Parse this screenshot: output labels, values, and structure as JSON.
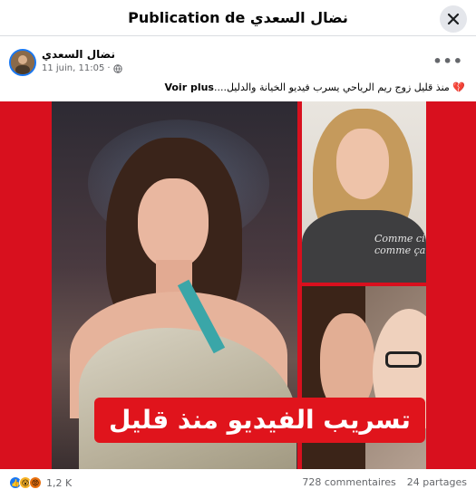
{
  "dialog": {
    "title": "Publication de نضال السعدي"
  },
  "post": {
    "author": "نضال السعدي",
    "date": "11 juin, 11:05",
    "privacy_separator": "·",
    "caption_text": "منذ قليل زوج ريم الرياحي يسرب فيديو الخيانة والدليل....",
    "see_more_label": "Voir plus",
    "overlay_text": "تسريب الفيديو منذ قليل",
    "shirt_text_line1": "Comme ci",
    "shirt_text_line2": "comme ça"
  },
  "engagement": {
    "reaction_count": "1,2 K",
    "comments": "728 commentaires",
    "shares": "24 partages"
  },
  "colors": {
    "accent": "#1877f2",
    "media_background": "#d8101e",
    "overlay": "#e0141c"
  },
  "icons": {
    "close": "close-icon",
    "globe": "globe-icon",
    "more": "more-options-icon",
    "heart": "broken-heart-icon"
  }
}
